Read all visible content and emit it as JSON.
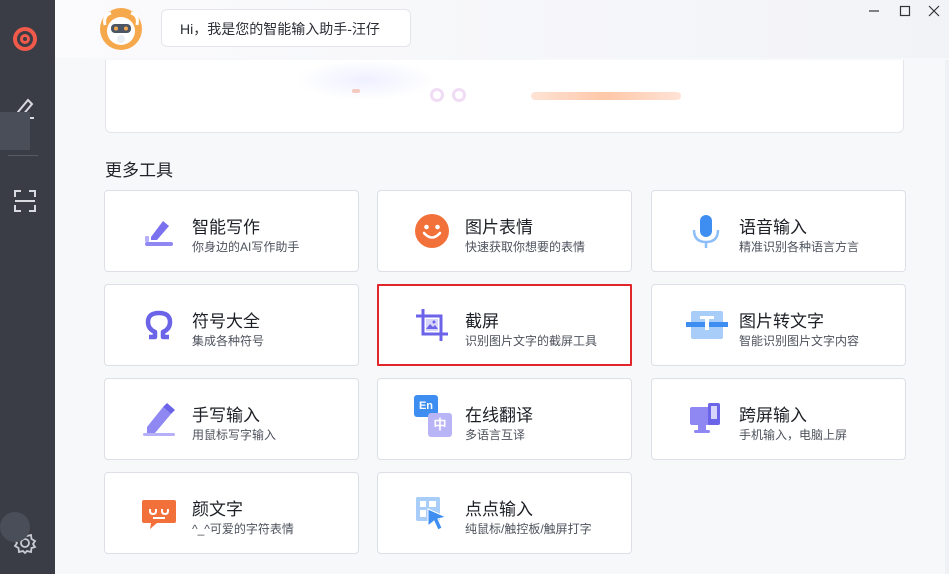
{
  "assistant": {
    "greeting": "Hi，我是您的智能输入助手-汪仔"
  },
  "window": {
    "minimize_icon": "minimize-icon",
    "maximize_icon": "maximize-icon",
    "close_icon": "close-icon"
  },
  "section": {
    "title": "更多工具"
  },
  "tools": [
    {
      "title": "智能写作",
      "desc": "你身边的AI写作助手",
      "icon": "pen-icon"
    },
    {
      "title": "图片表情",
      "desc": "快速获取你想要的表情",
      "icon": "smile-icon"
    },
    {
      "title": "语音输入",
      "desc": "精准识别各种语言方言",
      "icon": "microphone-icon"
    },
    {
      "title": "符号大全",
      "desc": "集成各种符号",
      "icon": "omega-icon"
    },
    {
      "title": "截屏",
      "desc": "识别图片文字的截屏工具",
      "icon": "screenshot-icon"
    },
    {
      "title": "图片转文字",
      "desc": "智能识别图片文字内容",
      "icon": "ocr-icon"
    },
    {
      "title": "手写输入",
      "desc": "用鼠标写字输入",
      "icon": "handwriting-icon"
    },
    {
      "title": "在线翻译",
      "desc": "多语言互译",
      "icon": "translate-icon"
    },
    {
      "title": "跨屏输入",
      "desc": "手机输入，电脑上屏",
      "icon": "cross-screen-icon"
    },
    {
      "title": "颜文字",
      "desc": "^_^可爱的字符表情",
      "icon": "kaomoji-icon"
    },
    {
      "title": "点点输入",
      "desc": "纯鼠标/触控板/触屏打字",
      "icon": "click-input-icon"
    }
  ],
  "translate_icon_text": {
    "en": "En",
    "zh": "中"
  },
  "selected_tool": "截屏",
  "colors": {
    "accent_red": "#e0262a",
    "icon_purple": "#6b63e8",
    "icon_orange": "#f2713a",
    "icon_blue": "#3d8ef0"
  }
}
